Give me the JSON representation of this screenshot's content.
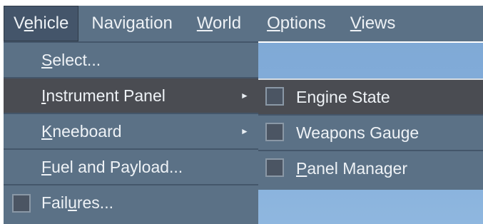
{
  "menubar": {
    "items": [
      {
        "pre": "V",
        "u": "e",
        "post": "hicle"
      },
      {
        "pre": "Navi",
        "u": "g",
        "post": "ation"
      },
      {
        "pre": "",
        "u": "W",
        "post": "orld"
      },
      {
        "pre": "",
        "u": "O",
        "post": "ptions"
      },
      {
        "pre": "",
        "u": "V",
        "post": "iews"
      }
    ]
  },
  "vehicle_menu": {
    "items": [
      {
        "pre": "",
        "u": "S",
        "post": "elect..."
      },
      {
        "pre": "",
        "u": "I",
        "post": "nstrument Panel",
        "arrow": "►"
      },
      {
        "pre": "",
        "u": "K",
        "post": "neeboard",
        "arrow": "►"
      },
      {
        "pre": "",
        "u": "F",
        "post": "uel and Payload..."
      },
      {
        "pre": "Fail",
        "u": "u",
        "post": "res..."
      }
    ]
  },
  "instrument_panel_submenu": {
    "items": [
      {
        "pre": "",
        "u": "",
        "post": "Engine State"
      },
      {
        "pre": "",
        "u": "",
        "post": "Weapons Gauge"
      },
      {
        "pre": "",
        "u": "P",
        "post": "anel Manager"
      }
    ]
  },
  "colors": {
    "menu_bg": "#5b7186",
    "highlight": "#4a4c52",
    "sky": "#86b0dc"
  }
}
